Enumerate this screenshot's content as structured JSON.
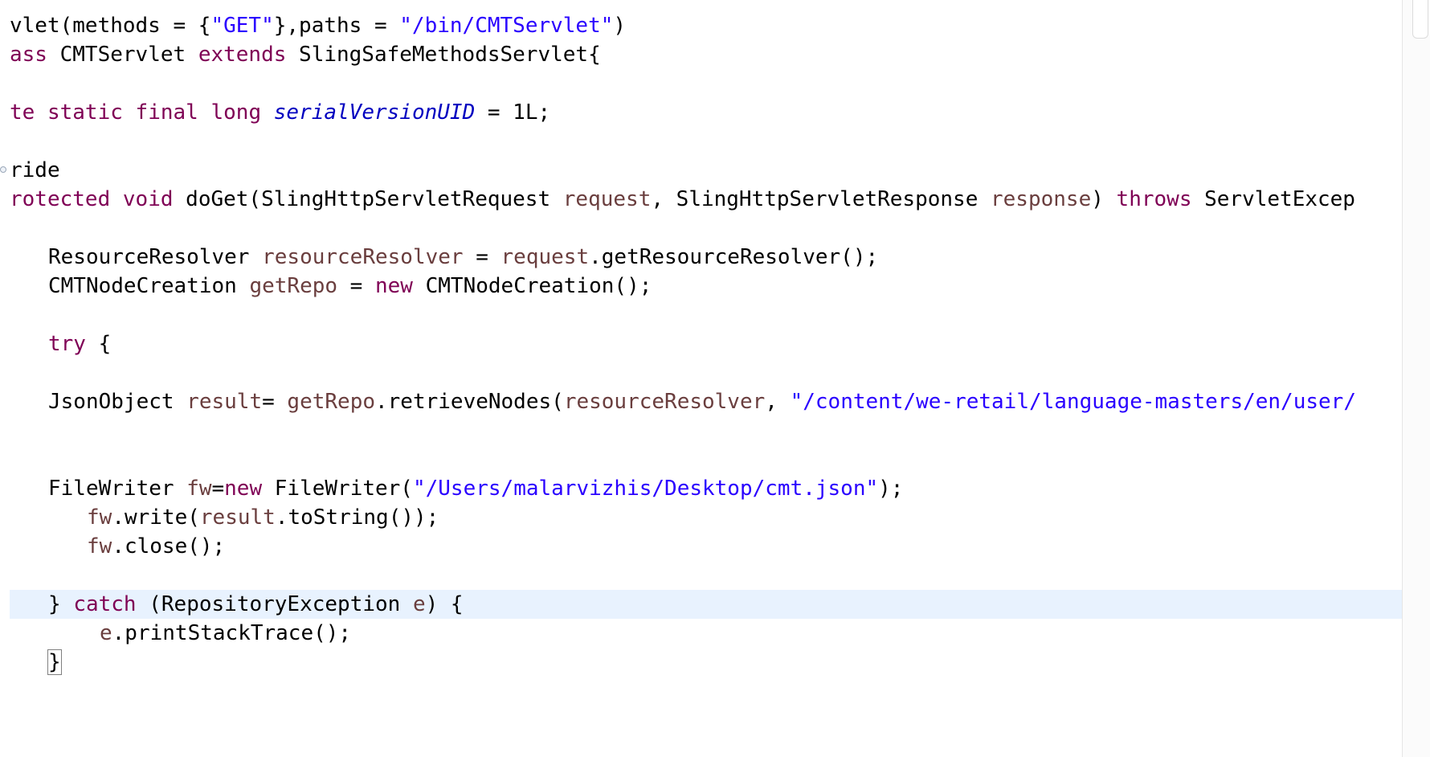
{
  "editor": {
    "lines": [
      {
        "tokens": [
          {
            "t": "vlet(methods = {",
            "c": "plain"
          },
          {
            "t": "\"GET\"",
            "c": "str"
          },
          {
            "t": "},paths = ",
            "c": "plain"
          },
          {
            "t": "\"/bin/CMTServlet\"",
            "c": "str"
          },
          {
            "t": ")",
            "c": "plain"
          }
        ]
      },
      {
        "tokens": [
          {
            "t": "ass",
            "c": "kw"
          },
          {
            "t": " CMTServlet ",
            "c": "plain"
          },
          {
            "t": "extends",
            "c": "kw"
          },
          {
            "t": " SlingSafeMethodsServlet{",
            "c": "plain"
          }
        ]
      },
      {
        "tokens": []
      },
      {
        "tokens": [
          {
            "t": "te",
            "c": "kw"
          },
          {
            "t": " ",
            "c": "plain"
          },
          {
            "t": "static",
            "c": "kw"
          },
          {
            "t": " ",
            "c": "plain"
          },
          {
            "t": "final",
            "c": "kw"
          },
          {
            "t": " ",
            "c": "plain"
          },
          {
            "t": "long",
            "c": "kw"
          },
          {
            "t": " ",
            "c": "plain"
          },
          {
            "t": "serialVersionUID",
            "c": "field"
          },
          {
            "t": " = 1L;",
            "c": "plain"
          }
        ]
      },
      {
        "tokens": []
      },
      {
        "marker": true,
        "tokens": [
          {
            "t": "ride",
            "c": "plain"
          }
        ]
      },
      {
        "tokens": [
          {
            "t": "rotected",
            "c": "kw"
          },
          {
            "t": " ",
            "c": "plain"
          },
          {
            "t": "void",
            "c": "kw"
          },
          {
            "t": " doGet(SlingHttpServletRequest ",
            "c": "plain"
          },
          {
            "t": "request",
            "c": "local"
          },
          {
            "t": ", SlingHttpServletResponse ",
            "c": "plain"
          },
          {
            "t": "response",
            "c": "local"
          },
          {
            "t": ") ",
            "c": "plain"
          },
          {
            "t": "throws",
            "c": "kw"
          },
          {
            "t": " ServletExcep",
            "c": "plain"
          }
        ]
      },
      {
        "tokens": []
      },
      {
        "indent": "ind1",
        "tokens": [
          {
            "t": "ResourceResolver ",
            "c": "plain"
          },
          {
            "t": "resourceResolver",
            "c": "local"
          },
          {
            "t": " = ",
            "c": "plain"
          },
          {
            "t": "request",
            "c": "local"
          },
          {
            "t": ".getResourceResolver();",
            "c": "plain"
          }
        ]
      },
      {
        "indent": "ind1",
        "tokens": [
          {
            "t": "CMTNodeCreation ",
            "c": "plain"
          },
          {
            "t": "getRepo",
            "c": "local"
          },
          {
            "t": " = ",
            "c": "plain"
          },
          {
            "t": "new",
            "c": "kw"
          },
          {
            "t": " CMTNodeCreation();",
            "c": "plain"
          }
        ]
      },
      {
        "tokens": []
      },
      {
        "indent": "ind1",
        "tokens": [
          {
            "t": "try",
            "c": "kw"
          },
          {
            "t": " {",
            "c": "plain"
          }
        ]
      },
      {
        "tokens": []
      },
      {
        "indent": "ind1",
        "tokens": [
          {
            "t": "JsonObject ",
            "c": "plain"
          },
          {
            "t": "result",
            "c": "local"
          },
          {
            "t": "= ",
            "c": "plain"
          },
          {
            "t": "getRepo",
            "c": "local"
          },
          {
            "t": ".retrieveNodes(",
            "c": "plain"
          },
          {
            "t": "resourceResolver",
            "c": "local"
          },
          {
            "t": ", ",
            "c": "plain"
          },
          {
            "t": "\"/content/we-retail/language-masters/en/user/",
            "c": "str"
          }
        ]
      },
      {
        "tokens": []
      },
      {
        "tokens": []
      },
      {
        "indent": "ind1",
        "tokens": [
          {
            "t": "FileWriter ",
            "c": "plain"
          },
          {
            "t": "fw",
            "c": "local"
          },
          {
            "t": "=",
            "c": "plain"
          },
          {
            "t": "new",
            "c": "kw"
          },
          {
            "t": " FileWriter(",
            "c": "plain"
          },
          {
            "t": "\"/Users/malarvizhis/Desktop/cmt.json\"",
            "c": "str"
          },
          {
            "t": ");",
            "c": "plain"
          }
        ]
      },
      {
        "indent": "ind2",
        "tokens": [
          {
            "t": "fw",
            "c": "local"
          },
          {
            "t": ".write(",
            "c": "plain"
          },
          {
            "t": "result",
            "c": "local"
          },
          {
            "t": ".toString());",
            "c": "plain"
          }
        ]
      },
      {
        "indent": "ind2",
        "tokens": [
          {
            "t": "fw",
            "c": "local"
          },
          {
            "t": ".close();",
            "c": "plain"
          }
        ]
      },
      {
        "tokens": []
      },
      {
        "indent": "ind1",
        "current": true,
        "tokens": [
          {
            "t": "} ",
            "c": "plain"
          },
          {
            "t": "catch",
            "c": "kw"
          },
          {
            "t": " (RepositoryException ",
            "c": "plain"
          },
          {
            "t": "e",
            "c": "local"
          },
          {
            "t": ") {",
            "c": "plain"
          }
        ]
      },
      {
        "indent": "ind3",
        "tokens": [
          {
            "t": "e",
            "c": "local"
          },
          {
            "t": ".printStackTrace();",
            "c": "plain"
          }
        ]
      },
      {
        "indent": "ind1",
        "tokens": [
          {
            "t": "}",
            "c": "plain",
            "box": true
          }
        ]
      }
    ]
  }
}
